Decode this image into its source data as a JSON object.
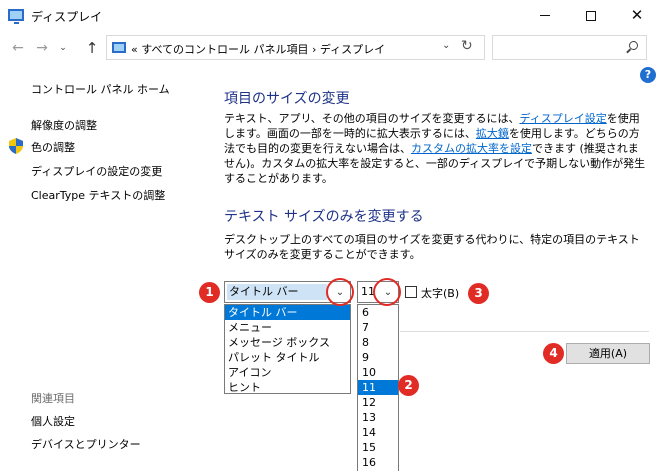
{
  "window": {
    "title": "ディスプレイ",
    "icon": "display-icon",
    "buttons": [
      "minimize-icon",
      "maximize-icon",
      "close-icon"
    ]
  },
  "address": {
    "back_glyph": "←",
    "forward_glyph": "→",
    "recent_glyph": "⌄",
    "up_glyph": "↑",
    "breadcrumb": "«  すべてのコントロール パネル項目  ›  ディスプレイ",
    "dropdown_glyph": "⌄",
    "refresh_glyph": "↻",
    "search_placeholder": ""
  },
  "help_label": "?",
  "sidebar": {
    "home": "コントロール パネル ホーム",
    "items": [
      "解像度の調整",
      "色の調整",
      "ディスプレイの設定の変更",
      "ClearType テキストの調整"
    ],
    "related_heading": "関連項目",
    "related_items": [
      "個人設定",
      "デバイスとプリンター"
    ]
  },
  "section1": {
    "heading": "項目のサイズの変更",
    "text_a": "テキスト、アプリ、その他の項目のサイズを変更するには、",
    "link1": "ディスプレイ設定",
    "text_b": "を使用します。画面の一部を一時的に拡大表示するには、",
    "link2": "拡大鏡",
    "text_c": "を使用します。どちらの方法でも目的の変更を行えない場合は、",
    "link3": "カスタムの拡大率を設定",
    "text_d": "できます (推奨されません)。カスタムの拡大率を設定すると、一部のディスプレイで予期しない動作が発生することがあります。"
  },
  "section2": {
    "heading": "テキスト サイズのみを変更する",
    "text": "デスクトップ上のすべての項目のサイズを変更する代わりに、特定の項目のテキスト サイズのみを変更することができます。"
  },
  "item_select": {
    "value": "タイトル バー",
    "arrow_glyph": "⌄",
    "options": [
      "タイトル バー",
      "メニュー",
      "メッセージ ボックス",
      "パレット タイトル",
      "アイコン",
      "ヒント"
    ],
    "selected_index": 0
  },
  "size_select": {
    "value": "11",
    "arrow_glyph": "⌄",
    "options": [
      "6",
      "7",
      "8",
      "9",
      "10",
      "11",
      "12",
      "13",
      "14",
      "15",
      "16"
    ],
    "selected_index": 5
  },
  "bold_label": "太字(B)",
  "apply_label": "適用(A)",
  "annotations": [
    "1",
    "2",
    "3",
    "4"
  ],
  "colors": {
    "heading": "#1e3287",
    "link": "#0066cc",
    "selection": "#0078d7",
    "annotation": "#e12b25"
  }
}
